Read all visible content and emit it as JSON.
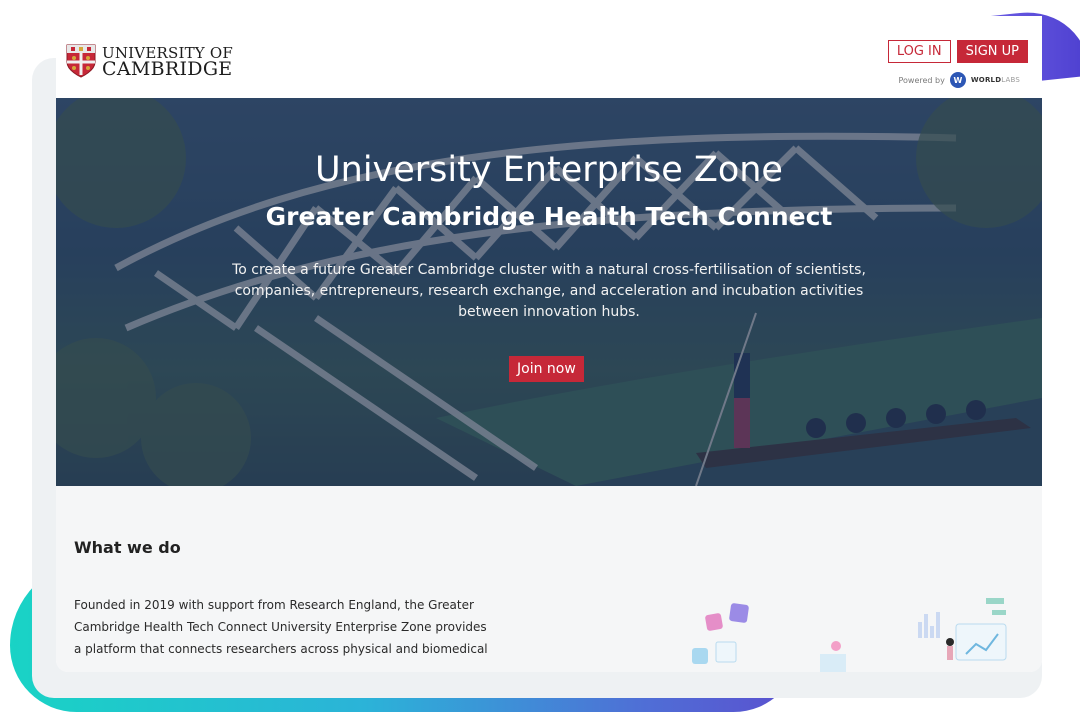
{
  "header": {
    "logo_line1": "UNIVERSITY OF",
    "logo_line2": "CAMBRIDGE",
    "login_label": "LOG IN",
    "signup_label": "SIGN UP",
    "powered_by": "Powered by",
    "worldlabs_bold": "WORLD",
    "worldlabs_light": "LABS"
  },
  "hero": {
    "title": "University Enterprise Zone",
    "subtitle": "Greater Cambridge Health Tech Connect",
    "description": "To create a future Greater Cambridge cluster with a natural cross-fertilisation of scientists, companies, entrepreneurs, research exchange, and acceleration and incubation activities between innovation hubs.",
    "cta_label": "Join now"
  },
  "section": {
    "title": "What we do",
    "body": "Founded in 2019 with support from Research England, the Greater Cambridge Health Tech Connect University Enterprise Zone provides a platform that connects researchers across physical and biomedical"
  },
  "colors": {
    "brand_red": "#c62838",
    "hero_overlay": "#223862",
    "deco_teal": "#19d3c5",
    "deco_purple": "#5b4fcf"
  }
}
